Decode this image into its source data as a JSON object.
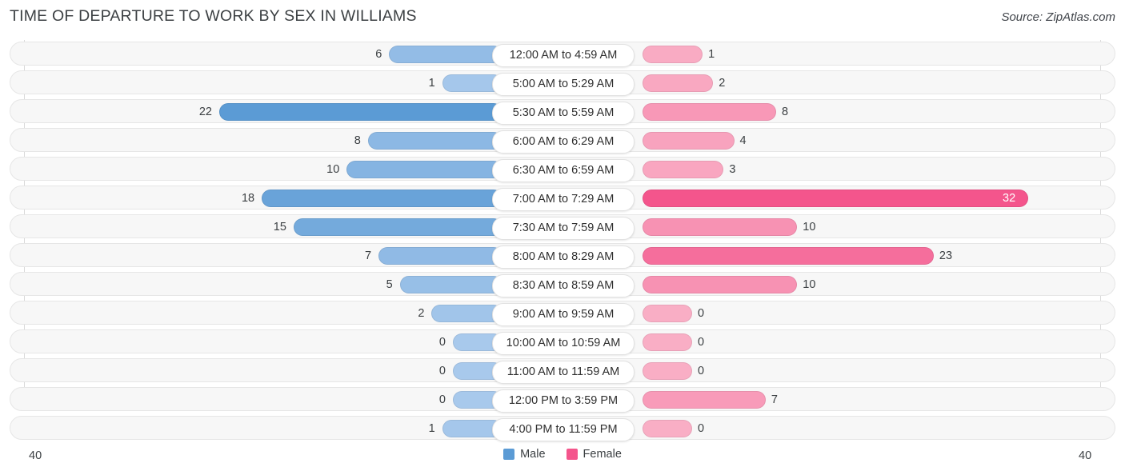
{
  "header": {
    "title": "TIME OF DEPARTURE TO WORK BY SEX IN WILLIAMS",
    "source": "Source: ZipAtlas.com"
  },
  "legend": {
    "items": [
      {
        "label": "Male",
        "color": "#5b9bd5"
      },
      {
        "label": "Female",
        "color": "#f4558c"
      }
    ]
  },
  "axis": {
    "left_label": "40",
    "right_label": "40"
  },
  "colors": {
    "male_strong": "#5b9bd5",
    "male_light": "#a8c9ec",
    "female_strong": "#f4558c",
    "female_light": "#f9aec5",
    "track": "#f7f7f7",
    "track_border": "#e6e6e6",
    "text": "#3c4043"
  },
  "chart_data": {
    "type": "bar",
    "subtype": "diverging-tornado",
    "title": "TIME OF DEPARTURE TO WORK BY SEX IN WILLIAMS",
    "xlabel": "",
    "ylabel": "",
    "xlim": [
      40,
      40
    ],
    "axis_max": 40,
    "grid": false,
    "legend_position": "bottom-center",
    "categories": [
      "12:00 AM to 4:59 AM",
      "5:00 AM to 5:29 AM",
      "5:30 AM to 5:59 AM",
      "6:00 AM to 6:29 AM",
      "6:30 AM to 6:59 AM",
      "7:00 AM to 7:29 AM",
      "7:30 AM to 7:59 AM",
      "8:00 AM to 8:29 AM",
      "8:30 AM to 8:59 AM",
      "9:00 AM to 9:59 AM",
      "10:00 AM to 10:59 AM",
      "11:00 AM to 11:59 AM",
      "12:00 PM to 3:59 PM",
      "4:00 PM to 11:59 PM"
    ],
    "series": [
      {
        "name": "Male",
        "direction": "left",
        "color": "#5b9bd5",
        "values": [
          6,
          1,
          22,
          8,
          10,
          18,
          15,
          7,
          5,
          2,
          0,
          0,
          0,
          1
        ]
      },
      {
        "name": "Female",
        "direction": "right",
        "color": "#f4558c",
        "values": [
          1,
          2,
          8,
          4,
          3,
          32,
          10,
          23,
          10,
          0,
          0,
          0,
          7,
          0
        ]
      }
    ]
  }
}
